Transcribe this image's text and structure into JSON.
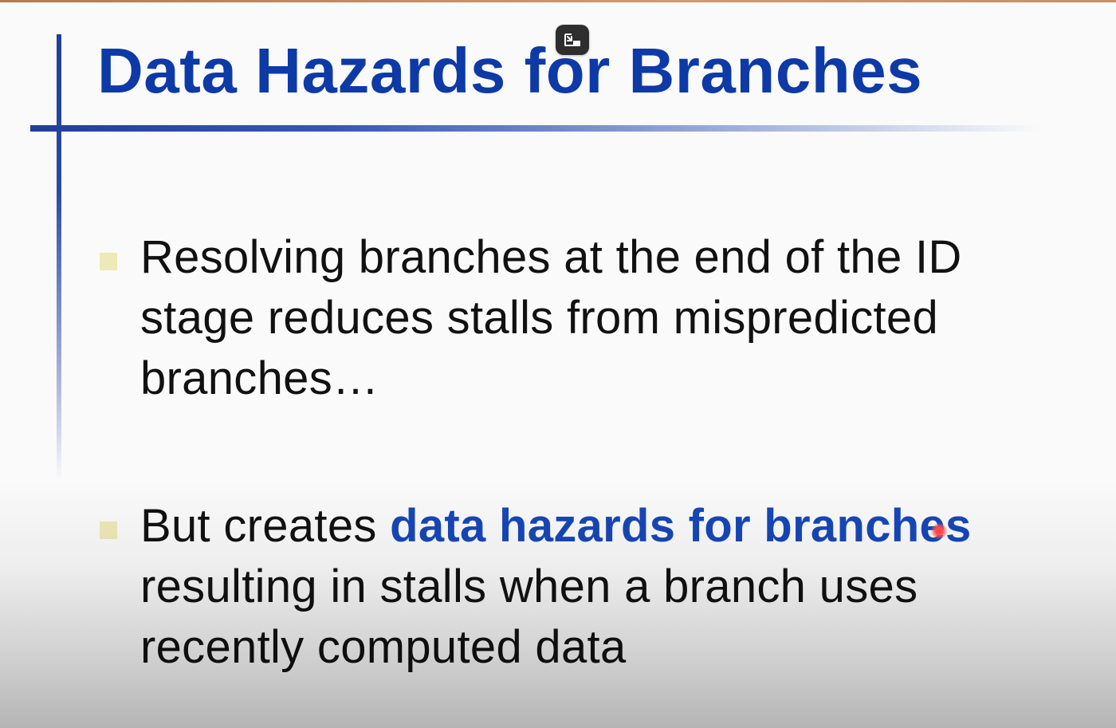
{
  "slide": {
    "title": "Data Hazards for Branches",
    "bullets": [
      {
        "lines": [
          "Resolving branches at the end of the ID",
          "stage reduces stalls from mispredicted",
          "branches…"
        ]
      },
      {
        "line1_prefix": "But creates ",
        "line1_emphasis": "data hazards for branches",
        "lines": [
          "resulting in stalls when a branch uses",
          "recently computed data"
        ]
      }
    ]
  },
  "overlay": {
    "exit_button_icon": "exit-picture-in-picture-icon",
    "pointer": "laser-pointer-dot"
  },
  "colors": {
    "title": "#0d3aa6",
    "emphasis": "#1747b8",
    "body_text": "#111111",
    "bullet": "#eee9b7",
    "rule": "#1f3f98"
  }
}
